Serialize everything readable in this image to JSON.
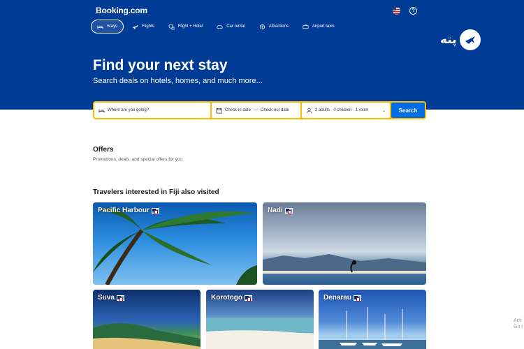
{
  "header": {
    "logo": "Booking.com",
    "language_icon": "us-flag-icon",
    "help_icon": "question-circle-icon"
  },
  "nav": {
    "items": [
      {
        "label": "Stays",
        "icon": "bed-icon",
        "active": true
      },
      {
        "label": "Flights",
        "icon": "plane-icon"
      },
      {
        "label": "Flight + Hotel",
        "icon": "plane-hotel-icon"
      },
      {
        "label": "Car rental",
        "icon": "car-icon"
      },
      {
        "label": "Attractions",
        "icon": "attractions-icon"
      },
      {
        "label": "Airport taxis",
        "icon": "taxi-icon"
      }
    ]
  },
  "brand_overlay": {
    "text": "پته"
  },
  "hero": {
    "title": "Find your next stay",
    "subtitle": "Search deals on hotels, homes, and much more..."
  },
  "search": {
    "destination_placeholder": "Where are you going?",
    "checkin": "Check-in date",
    "dash": "—",
    "checkout": "Check-out date",
    "guests": "2 adults · 0 children · 1 room",
    "button": "Search"
  },
  "offers": {
    "title": "Offers",
    "subtitle": "Promotions, deals, and special offers for you"
  },
  "destinations": {
    "title": "Travelers interested in Fiji also visited",
    "cards": [
      {
        "name": "Pacific Harbour"
      },
      {
        "name": "Nadi"
      },
      {
        "name": "Suva"
      },
      {
        "name": "Korotogo"
      },
      {
        "name": "Denarau"
      }
    ]
  },
  "watermark": {
    "line1": "Acti",
    "line2": "Go t"
  },
  "colors": {
    "brand_blue": "#003b95",
    "search_yellow": "#febb02",
    "button_blue": "#006ce4"
  }
}
